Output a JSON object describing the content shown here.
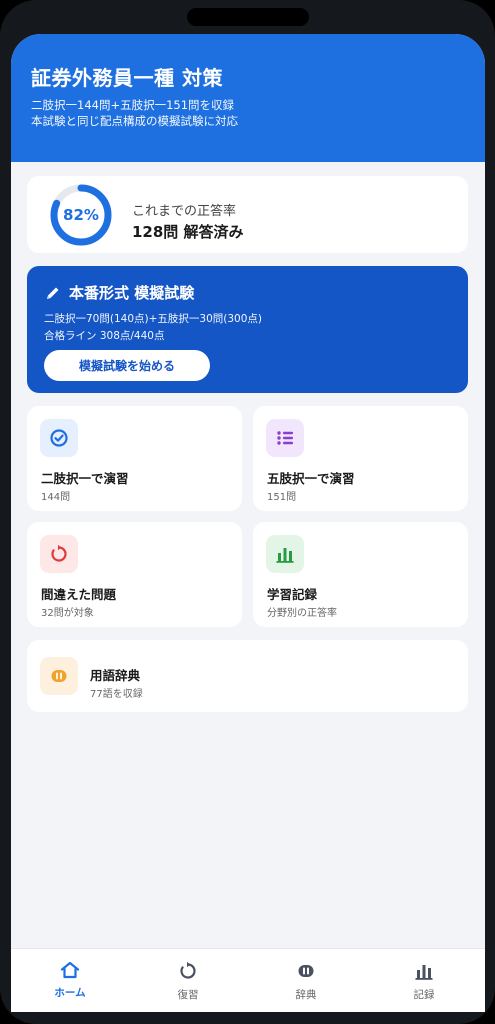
{
  "header": {
    "title": "証券外務員一種 対策",
    "sub_line1": "二肢択一144問+五肢択一151問を収録",
    "sub_line2": "本試験と同じ配点構成の模擬試験に対応"
  },
  "score": {
    "percent_label": "82%",
    "percent_value": 82,
    "label": "これまでの正答率",
    "count": "128問 解答済み"
  },
  "exam": {
    "title": "本番形式 模擬試験",
    "line1": "二肢択一70問(140点)+五肢択一30問(300点)",
    "line2": "合格ライン 308点/440点",
    "button": "模擬試験を始める"
  },
  "tiles": [
    {
      "title": "二肢択一で演習",
      "sub": "144問",
      "icon": "check-circle-icon"
    },
    {
      "title": "五肢択一で演習",
      "sub": "151問",
      "icon": "list-icon"
    },
    {
      "title": "間違えた問題",
      "sub": "32問が対象",
      "icon": "retry-icon"
    },
    {
      "title": "学習記録",
      "sub": "分野別の正答率",
      "icon": "bar-chart-icon"
    }
  ],
  "dictionary": {
    "title": "用語辞典",
    "sub": "77語を収録",
    "icon": "book-icon"
  },
  "tabs": [
    {
      "label": "ホーム",
      "icon": "home-icon",
      "active": true
    },
    {
      "label": "復習",
      "icon": "retry-icon",
      "active": false
    },
    {
      "label": "辞典",
      "icon": "book-icon",
      "active": false
    },
    {
      "label": "記録",
      "icon": "bar-chart-icon",
      "active": false
    }
  ],
  "colors": {
    "primary": "#1e6fe0",
    "exam_card": "#1556c7",
    "background": "#f2f4f8"
  }
}
